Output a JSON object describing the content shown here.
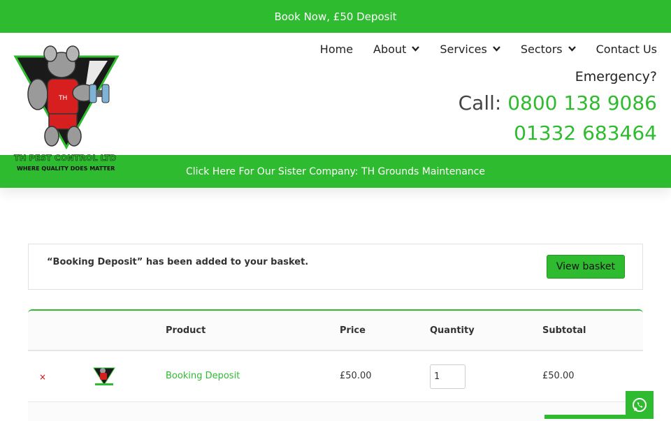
{
  "topbar": {
    "text": "Book Now, £50 Deposit"
  },
  "nav": {
    "items": [
      {
        "label": "Home",
        "dropdown": false
      },
      {
        "label": "About",
        "dropdown": true
      },
      {
        "label": "Services",
        "dropdown": true
      },
      {
        "label": "Sectors",
        "dropdown": true
      },
      {
        "label": "Contact Us",
        "dropdown": false
      }
    ]
  },
  "logo": {
    "line1": "TH PEST CONTROL LTD",
    "line2": "WHERE QUALITY DOES MATTER",
    "shirt": "TH"
  },
  "contact": {
    "emergency": "Emergency?",
    "call_prefix": "Call: ",
    "phone1": "0800 138 9086",
    "phone2": "01332 683464"
  },
  "sister": {
    "text": "Click Here For Our Sister Company: TH Grounds Maintenance"
  },
  "notice": {
    "message": "“Booking Deposit” has been added to your basket.",
    "button": "View basket"
  },
  "cart": {
    "headers": {
      "product": "Product",
      "price": "Price",
      "quantity": "Quantity",
      "subtotal": "Subtotal"
    },
    "rows": [
      {
        "remove": "×",
        "product": "Booking Deposit",
        "price": "£50.00",
        "quantity": "1",
        "subtotal": "£50.00"
      }
    ]
  },
  "colors": {
    "brand_green": "#2fbb2f",
    "remove_red": "#cc0000"
  },
  "icons": {
    "whatsapp": "whatsapp-icon",
    "dropdown": "chevron-down-icon",
    "remove": "remove-icon"
  }
}
